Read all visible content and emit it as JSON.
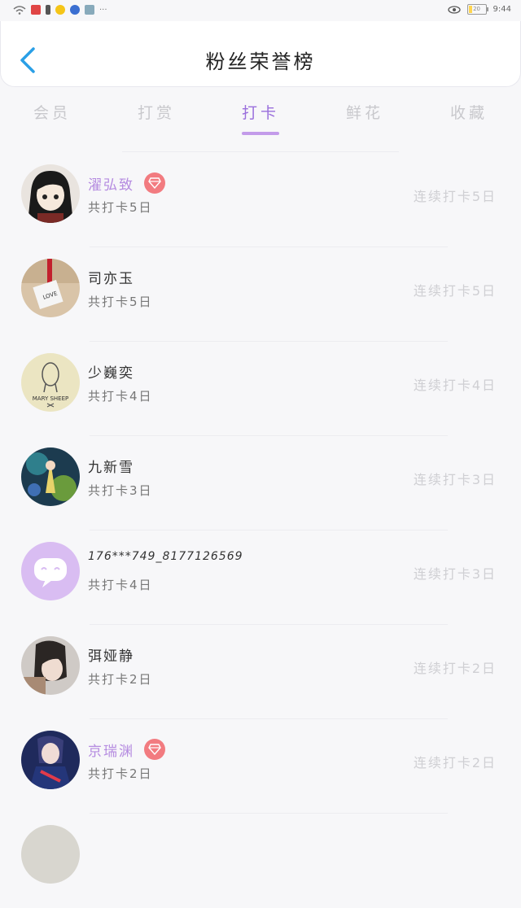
{
  "status_bar": {
    "time": "9:44",
    "battery": "20"
  },
  "header": {
    "title": "粉丝荣誉榜"
  },
  "tabs": [
    {
      "label": "会员",
      "active": false
    },
    {
      "label": "打赏",
      "active": false
    },
    {
      "label": "打卡",
      "active": true
    },
    {
      "label": "鲜花",
      "active": false
    },
    {
      "label": "收藏",
      "active": false
    }
  ],
  "list": [
    {
      "name": "濯弘致",
      "vip": true,
      "total": "共打卡5日",
      "streak": "连续打卡5日"
    },
    {
      "name": "司亦玉",
      "vip": false,
      "total": "共打卡5日",
      "streak": "连续打卡5日"
    },
    {
      "name": "少巍奕",
      "vip": false,
      "total": "共打卡4日",
      "streak": "连续打卡4日",
      "avatar_text": "MARY SHEEP"
    },
    {
      "name": "九新雪",
      "vip": false,
      "total": "共打卡3日",
      "streak": "连续打卡3日"
    },
    {
      "name": "176***749_8177126569",
      "vip": false,
      "total": "共打卡4日",
      "streak": "连续打卡3日"
    },
    {
      "name": "弭娅静",
      "vip": false,
      "total": "共打卡2日",
      "streak": "连续打卡2日"
    },
    {
      "name": "京瑞渊",
      "vip": true,
      "total": "共打卡2日",
      "streak": "连续打卡2日"
    }
  ],
  "colors": {
    "accent": "#9a6fdc",
    "vip_name": "#b58be0",
    "vip_badge": "#f27b80",
    "back_arrow": "#2a9fe6"
  }
}
